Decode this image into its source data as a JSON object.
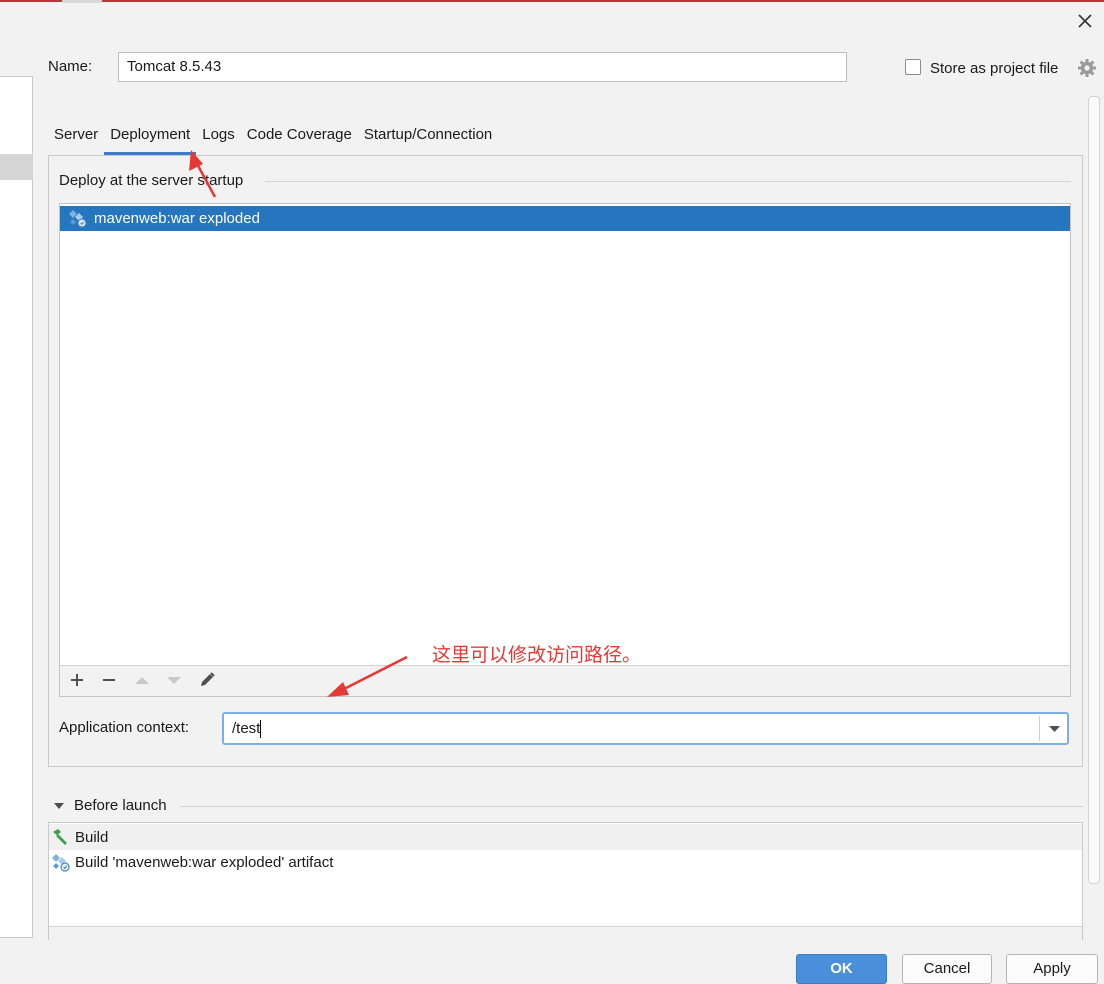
{
  "dialog": {
    "name_label": "Name:",
    "name_value": "Tomcat 8.5.43",
    "store_label": "Store as project file",
    "store_checked": false
  },
  "tabs": [
    {
      "label": "Server",
      "active": false
    },
    {
      "label": "Deployment",
      "active": true
    },
    {
      "label": "Logs",
      "active": false
    },
    {
      "label": "Code Coverage",
      "active": false
    },
    {
      "label": "Startup/Connection",
      "active": false
    }
  ],
  "deployment": {
    "section_title": "Deploy at the server startup",
    "artifacts": [
      {
        "label": "mavenweb:war exploded",
        "selected": true
      }
    ],
    "toolbar_icons": [
      "plus-icon",
      "minus-icon",
      "move-up-icon",
      "move-down-icon",
      "edit-icon"
    ],
    "annotation": "这里可以修改访问路径。",
    "context_label": "Application context:",
    "context_value": "/test"
  },
  "before_launch": {
    "title": "Before launch",
    "items": [
      {
        "label": "Build",
        "icon": "hammer-icon"
      },
      {
        "label": "Build 'mavenweb:war exploded' artifact",
        "icon": "artifact-icon"
      }
    ]
  },
  "buttons": {
    "ok": "OK",
    "cancel": "Cancel",
    "apply": "Apply"
  },
  "colors": {
    "accent": "#2675bf",
    "annotation": "#e53935",
    "ok_button": "#4a8fd9"
  }
}
